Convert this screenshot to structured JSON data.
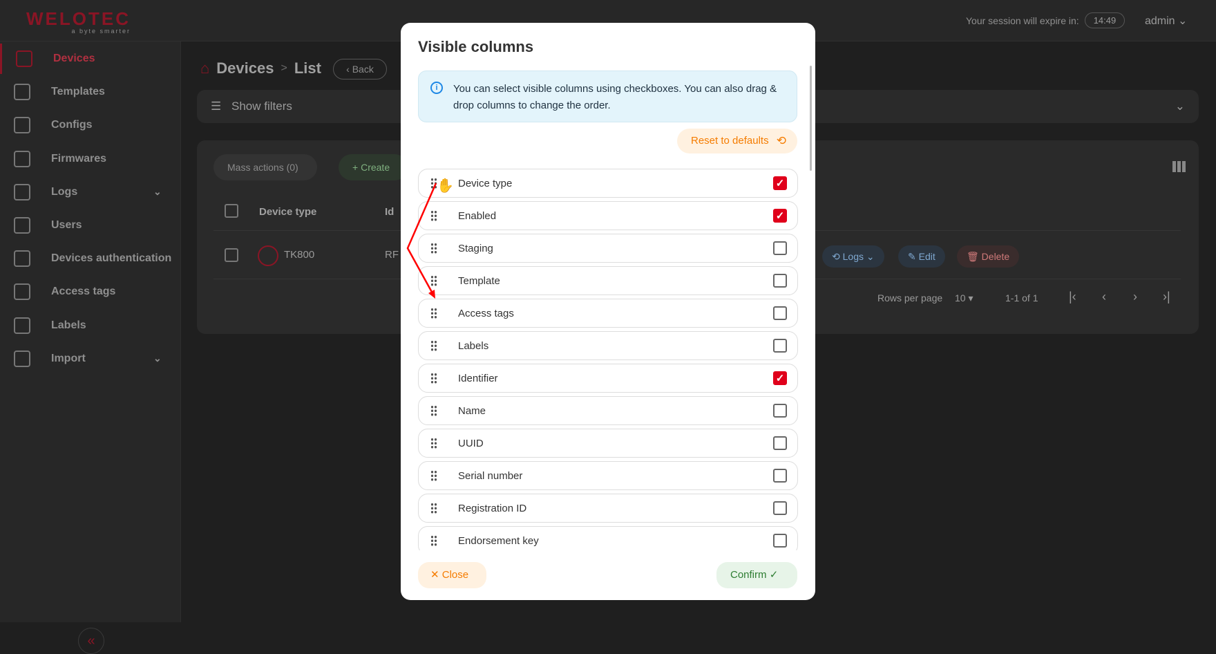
{
  "header": {
    "brand": "welotec",
    "tagline": "a byte smarter",
    "session_label": "Your session will expire in:",
    "session_time": "14:49",
    "user": "admin"
  },
  "sidebar": {
    "items": [
      {
        "label": "Devices",
        "icon": "router-icon",
        "active": true
      },
      {
        "label": "Templates",
        "icon": "copy-icon"
      },
      {
        "label": "Configs",
        "icon": "gear-icon"
      },
      {
        "label": "Firmwares",
        "icon": "chip-icon"
      },
      {
        "label": "Logs",
        "icon": "history-icon",
        "expandable": true
      },
      {
        "label": "Users",
        "icon": "user-icon"
      },
      {
        "label": "Devices authentication",
        "icon": "key-icon"
      },
      {
        "label": "Access tags",
        "icon": "lock-icon"
      },
      {
        "label": "Labels",
        "icon": "label-icon"
      },
      {
        "label": "Import",
        "icon": "download-icon",
        "expandable": true
      }
    ],
    "collapse": "«"
  },
  "page": {
    "title": "Devices",
    "sub": "List",
    "back": "Back",
    "filters": "Show filters"
  },
  "table": {
    "mass_actions": "Mass actions (0)",
    "create": "Create",
    "columns": [
      "Device type",
      "Id"
    ],
    "rows": [
      {
        "device_type": "TK800",
        "id": "RF"
      }
    ],
    "actions": {
      "logs": "Logs",
      "edit": "Edit",
      "delete": "Delete"
    },
    "rows_per_page_label": "Rows per page",
    "rows_per_page": "10",
    "range": "1-1 of 1"
  },
  "modal": {
    "title": "Visible columns",
    "info": "You can select visible columns using checkboxes. You can also drag & drop columns to change the order.",
    "reset": "Reset to defaults",
    "columns": [
      {
        "label": "Device type",
        "checked": true
      },
      {
        "label": "Enabled",
        "checked": true
      },
      {
        "label": "Staging",
        "checked": false
      },
      {
        "label": "Template",
        "checked": false
      },
      {
        "label": "Access tags",
        "checked": false
      },
      {
        "label": "Labels",
        "checked": false
      },
      {
        "label": "Identifier",
        "checked": true
      },
      {
        "label": "Name",
        "checked": false
      },
      {
        "label": "UUID",
        "checked": false
      },
      {
        "label": "Serial number",
        "checked": false
      },
      {
        "label": "Registration ID",
        "checked": false
      },
      {
        "label": "Endorsement key",
        "checked": false
      }
    ],
    "close": "Close",
    "confirm": "Confirm"
  },
  "colors": {
    "brand": "#c00018",
    "checkbox": "#e0001b",
    "reset": "#f57c00",
    "confirm": "#2e7d32",
    "annotation": "#ff0000"
  }
}
